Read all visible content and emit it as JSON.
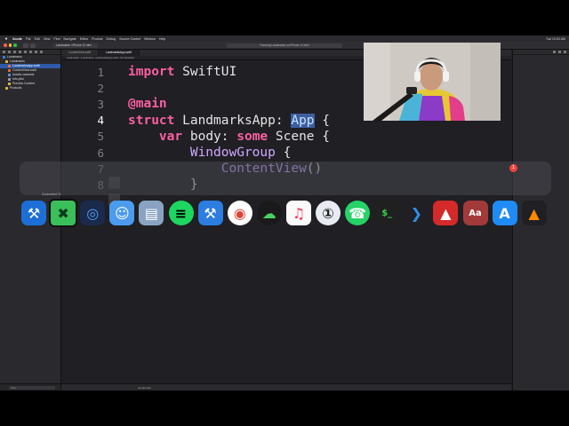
{
  "menubar": {
    "app_name": "Xcode",
    "items": [
      "File",
      "Edit",
      "View",
      "Find",
      "Navigate",
      "Editor",
      "Product",
      "Debug",
      "Source Control",
      "Window",
      "Help"
    ],
    "clock": "Sat 10:53 AM"
  },
  "toolbar": {
    "scheme": "Landmarks › iPhone 12 mini",
    "activity": "Running Landmarks on iPhone 12 mini"
  },
  "navigator": {
    "items": [
      {
        "label": "Landmarks",
        "indent": 0,
        "icon_color": "#3d7bd9",
        "selected": false
      },
      {
        "label": "Landmarks",
        "indent": 1,
        "icon_color": "#e0b440",
        "selected": false
      },
      {
        "label": "LandmarksApp.swift",
        "indent": 2,
        "icon_color": "#e86a3a",
        "selected": true
      },
      {
        "label": "ContentView.swift",
        "indent": 2,
        "icon_color": "#e86a3a",
        "selected": false
      },
      {
        "label": "Assets.xcassets",
        "indent": 2,
        "icon_color": "#5b8fd8",
        "selected": false
      },
      {
        "label": "Info.plist",
        "indent": 2,
        "icon_color": "#9a9a9a",
        "selected": false
      },
      {
        "label": "Preview Content",
        "indent": 2,
        "icon_color": "#e0b440",
        "selected": false
      },
      {
        "label": "Products",
        "indent": 1,
        "icon_color": "#e0b440",
        "selected": false
      }
    ],
    "filter_placeholder": "Filter"
  },
  "editor": {
    "tabs": [
      {
        "label": "ContentView.swift",
        "active": false
      },
      {
        "label": "LandmarksApp.swift",
        "active": true
      }
    ],
    "jumpbar": "Landmarks › Landmarks › LandmarksApp.swift › No Selection",
    "current_line": 4,
    "lines": [
      {
        "num": "1",
        "tokens": [
          {
            "t": "import",
            "c": "kw"
          },
          {
            "t": " SwiftUI",
            "c": ""
          }
        ]
      },
      {
        "num": "2",
        "tokens": []
      },
      {
        "num": "3",
        "tokens": [
          {
            "t": "@main",
            "c": "kw"
          }
        ]
      },
      {
        "num": "4",
        "tokens": [
          {
            "t": "struct",
            "c": "kw"
          },
          {
            "t": " LandmarksApp: ",
            "c": ""
          },
          {
            "t": "App",
            "c": "sel"
          },
          {
            "t": " {",
            "c": ""
          }
        ]
      },
      {
        "num": "5",
        "tokens": [
          {
            "t": "    ",
            "c": ""
          },
          {
            "t": "var",
            "c": "kw"
          },
          {
            "t": " body: ",
            "c": ""
          },
          {
            "t": "some",
            "c": "kw"
          },
          {
            "t": " Scene {",
            "c": ""
          }
        ]
      },
      {
        "num": "6",
        "tokens": [
          {
            "t": "        ",
            "c": ""
          },
          {
            "t": "WindowGroup",
            "c": "ty"
          },
          {
            "t": " {",
            "c": ""
          }
        ]
      },
      {
        "num": "7",
        "tokens": [
          {
            "t": "            ",
            "c": ""
          },
          {
            "t": "ContentView",
            "c": "ty"
          },
          {
            "t": "()",
            "c": ""
          }
        ]
      },
      {
        "num": "8",
        "tokens": [
          {
            "t": "        }",
            "c": ""
          }
        ]
      }
    ]
  },
  "statusbar": {
    "text": "Landmarks"
  },
  "dock": {
    "tooltip": "Connected To",
    "badge": "1",
    "apps": [
      {
        "name": "xcode-icon",
        "bg": "#1c6fd6",
        "glyph": "⚒",
        "fg": "#ffffff"
      },
      {
        "name": "connected-to-icon",
        "bg": "#3bbf5a",
        "glyph": "✖",
        "fg": "#0b3a1a",
        "hover": true
      },
      {
        "name": "proxyman-icon",
        "bg": "#1b2a4a",
        "glyph": "◎",
        "fg": "#4aa3ff"
      },
      {
        "name": "finder-icon",
        "bg": "#4b9bef",
        "glyph": "☺",
        "fg": "#ffffff"
      },
      {
        "name": "preview-icon",
        "bg": "#8aa3c2",
        "glyph": "▤",
        "fg": "#ffffff"
      },
      {
        "name": "spotify-icon",
        "bg": "#1ed760",
        "glyph": "≡",
        "fg": "#000000",
        "round": true
      },
      {
        "name": "xcode-simulator-icon",
        "bg": "#2b7de0",
        "glyph": "⚒",
        "fg": "#ffffff"
      },
      {
        "name": "chrome-icon",
        "bg": "#ffffff",
        "glyph": "◉",
        "fg": "#db4437",
        "round": true
      },
      {
        "name": "cloud-app-icon",
        "bg": "#1a1a1a",
        "glyph": "☁",
        "fg": "#4ad05f",
        "round": true
      },
      {
        "name": "music-icon",
        "bg": "#fafafa",
        "glyph": "♫",
        "fg": "#fa2d55"
      },
      {
        "name": "1password-icon",
        "bg": "#e8ecf2",
        "glyph": "①",
        "fg": "#1a1a1a",
        "round": true
      },
      {
        "name": "whatsapp-icon",
        "bg": "#25d366",
        "glyph": "☎",
        "fg": "#ffffff",
        "round": true
      },
      {
        "name": "terminal-icon",
        "bg": "#202020",
        "glyph": "$_",
        "fg": "#35d04a"
      },
      {
        "name": "vscode-icon",
        "bg": "#1f1f24",
        "glyph": "❯",
        "fg": "#2f8fe8"
      },
      {
        "name": "transmit-icon",
        "bg": "#d42a2a",
        "glyph": "▲",
        "fg": "#ffffff"
      },
      {
        "name": "dictionary-icon",
        "bg": "#a33a3a",
        "glyph": "Aa",
        "fg": "#ffffff"
      },
      {
        "name": "app-store-icon",
        "bg": "#1f8bf5",
        "glyph": "A",
        "fg": "#ffffff"
      },
      {
        "name": "vlc-icon",
        "bg": "#1f1f24",
        "glyph": "▲",
        "fg": "#ff8a00"
      }
    ]
  },
  "colors": {
    "editor_bg": "#1f1f24",
    "keyword": "#fc5fa3",
    "type": "#d0a8ff",
    "selection": "#3c5fa0"
  }
}
